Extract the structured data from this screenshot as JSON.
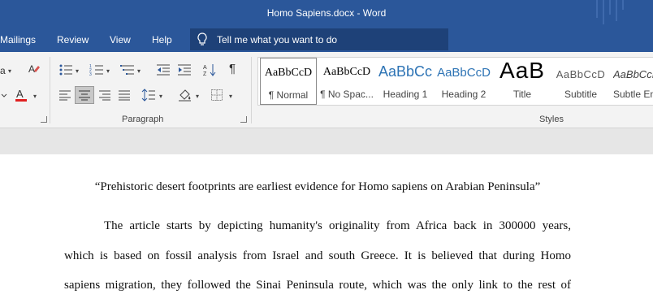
{
  "window": {
    "title": "Homo Sapiens.docx  -  Word"
  },
  "menu": {
    "tabs": [
      "Mailings",
      "Review",
      "View",
      "Help"
    ],
    "tell_me": "Tell me what you want to do"
  },
  "ribbon": {
    "groups": {
      "paragraph": "Paragraph",
      "styles": "Styles"
    },
    "styles": [
      {
        "preview": "AaBbCcD",
        "name": "¶ Normal",
        "color": "#000000"
      },
      {
        "preview": "AaBbCcD",
        "name": "¶ No Spac...",
        "color": "#000000"
      },
      {
        "preview": "AaBbCc",
        "name": "Heading 1",
        "color": "#2e74b5"
      },
      {
        "preview": "AaBbCcD",
        "name": "Heading 2",
        "color": "#2e74b5"
      },
      {
        "preview": "AaB",
        "name": "Title",
        "color": "#000000"
      },
      {
        "preview": "AaBbCcD",
        "name": "Subtitle",
        "color": "#5a5a5a"
      },
      {
        "preview": "AaBbCcD",
        "name": "Subtle Em",
        "color": "#404040"
      }
    ]
  },
  "document": {
    "heading": "“Prehistoric desert footprints are earliest evidence for Homo sapiens on Arabian Peninsula”",
    "lines": [
      "The article starts by depicting humanity's originality from Africa back in 300000 years,",
      "which is based on fossil analysis from Israel and south Greece. It is believed that during Homo",
      "sapiens migration, they followed the Sinai Peninsula route, which was the only link to the rest of"
    ]
  },
  "colors": {
    "accent": "#2b579a",
    "tell_me_bg": "#1e4178",
    "ribbon_bg": "#f3f3f3",
    "font_color_bar": "#e02020"
  }
}
